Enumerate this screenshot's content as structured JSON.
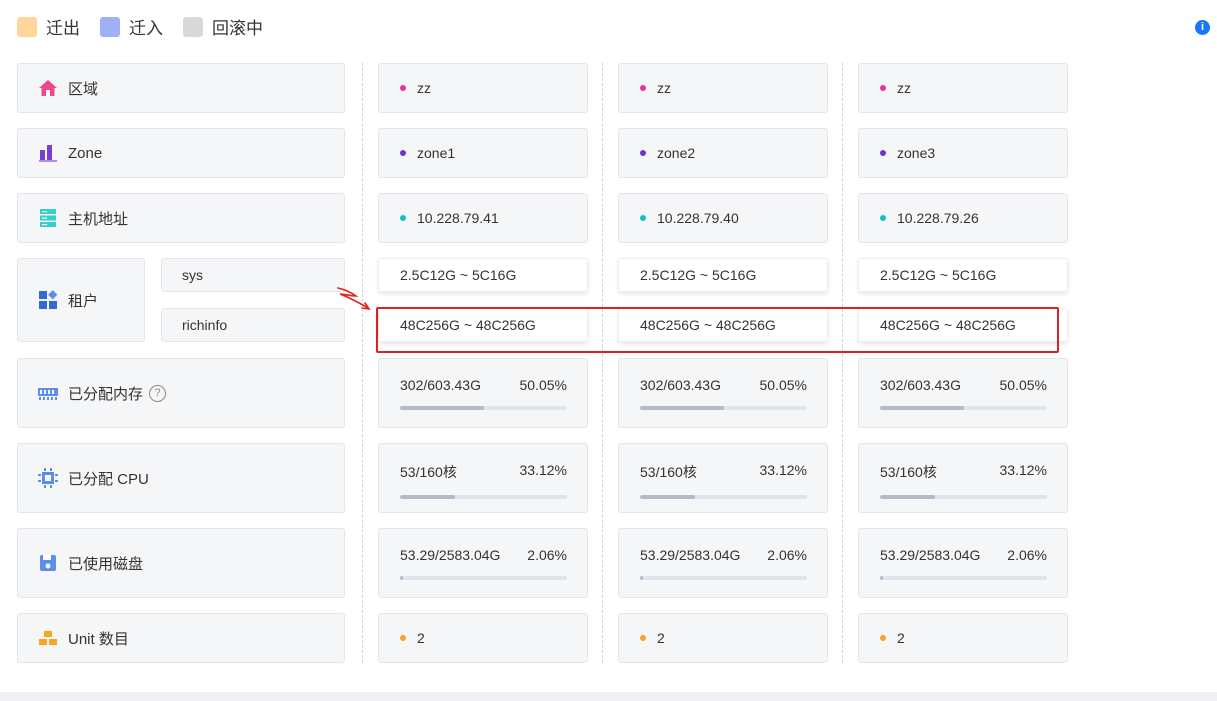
{
  "legend": [
    {
      "label": "迁出",
      "color": "#ffd59a"
    },
    {
      "label": "迁入",
      "color": "#9fb0f7"
    },
    {
      "label": "回滚中",
      "color": "#d9d9d9"
    }
  ],
  "rows": {
    "region": {
      "label": "区域",
      "icon": "home-icon",
      "icon_color": "#e84a8a",
      "dot_color": "#e8368f"
    },
    "zone": {
      "label": "Zone",
      "icon": "bar-chart-icon",
      "icon_color": "#7a3fd1",
      "dot_color": "#6a35c8"
    },
    "host": {
      "label": "主机地址",
      "icon": "server-icon",
      "icon_color": "#36cfc9",
      "dot_color": "#13c2c2"
    },
    "tenant": {
      "label": "租户",
      "icon": "apps-icon",
      "icon_color": "#2f6bd6",
      "subs": [
        "sys",
        "richinfo"
      ]
    },
    "memory": {
      "label": "已分配内存",
      "icon": "memory-icon",
      "icon_color": "#5b8def",
      "help": "?"
    },
    "cpu": {
      "label": "已分配 CPU",
      "icon": "cpu-icon",
      "icon_color": "#5b8def"
    },
    "disk": {
      "label": "已使用磁盘",
      "icon": "disk-icon",
      "icon_color": "#5b8def"
    },
    "unit": {
      "label": "Unit 数目",
      "icon": "units-icon",
      "icon_color": "#f5a623",
      "dot_color": "#f5a623"
    }
  },
  "servers": [
    {
      "region": "zz",
      "zone": "zone1",
      "host": "10.228.79.41",
      "tenant_sys": "2.5C12G ~ 5C16G",
      "tenant_richinfo": "48C256G ~ 48C256G",
      "memory": {
        "value": "302/603.43G",
        "percent": "50.05%",
        "ratio": 0.5005
      },
      "cpu": {
        "value": "53/160核",
        "percent": "33.12%",
        "ratio": 0.3312
      },
      "disk": {
        "value": "53.29/2583.04G",
        "percent": "2.06%",
        "ratio": 0.0206
      },
      "units": "2"
    },
    {
      "region": "zz",
      "zone": "zone2",
      "host": "10.228.79.40",
      "tenant_sys": "2.5C12G ~ 5C16G",
      "tenant_richinfo": "48C256G ~ 48C256G",
      "memory": {
        "value": "302/603.43G",
        "percent": "50.05%",
        "ratio": 0.5005
      },
      "cpu": {
        "value": "53/160核",
        "percent": "33.12%",
        "ratio": 0.3312
      },
      "disk": {
        "value": "53.29/2583.04G",
        "percent": "2.06%",
        "ratio": 0.0206
      },
      "units": "2"
    },
    {
      "region": "zz",
      "zone": "zone3",
      "host": "10.228.79.26",
      "tenant_sys": "2.5C12G ~ 5C16G",
      "tenant_richinfo": "48C256G ~ 48C256G",
      "memory": {
        "value": "302/603.43G",
        "percent": "50.05%",
        "ratio": 0.5005
      },
      "cpu": {
        "value": "53/160核",
        "percent": "33.12%",
        "ratio": 0.3312
      },
      "disk": {
        "value": "53.29/2583.04G",
        "percent": "2.06%",
        "ratio": 0.0206
      },
      "units": "2"
    }
  ],
  "colors": {
    "highlight_box": "#e02020",
    "bar_fill": "#b4bbc8",
    "bar_track": "#dfe3ea"
  }
}
